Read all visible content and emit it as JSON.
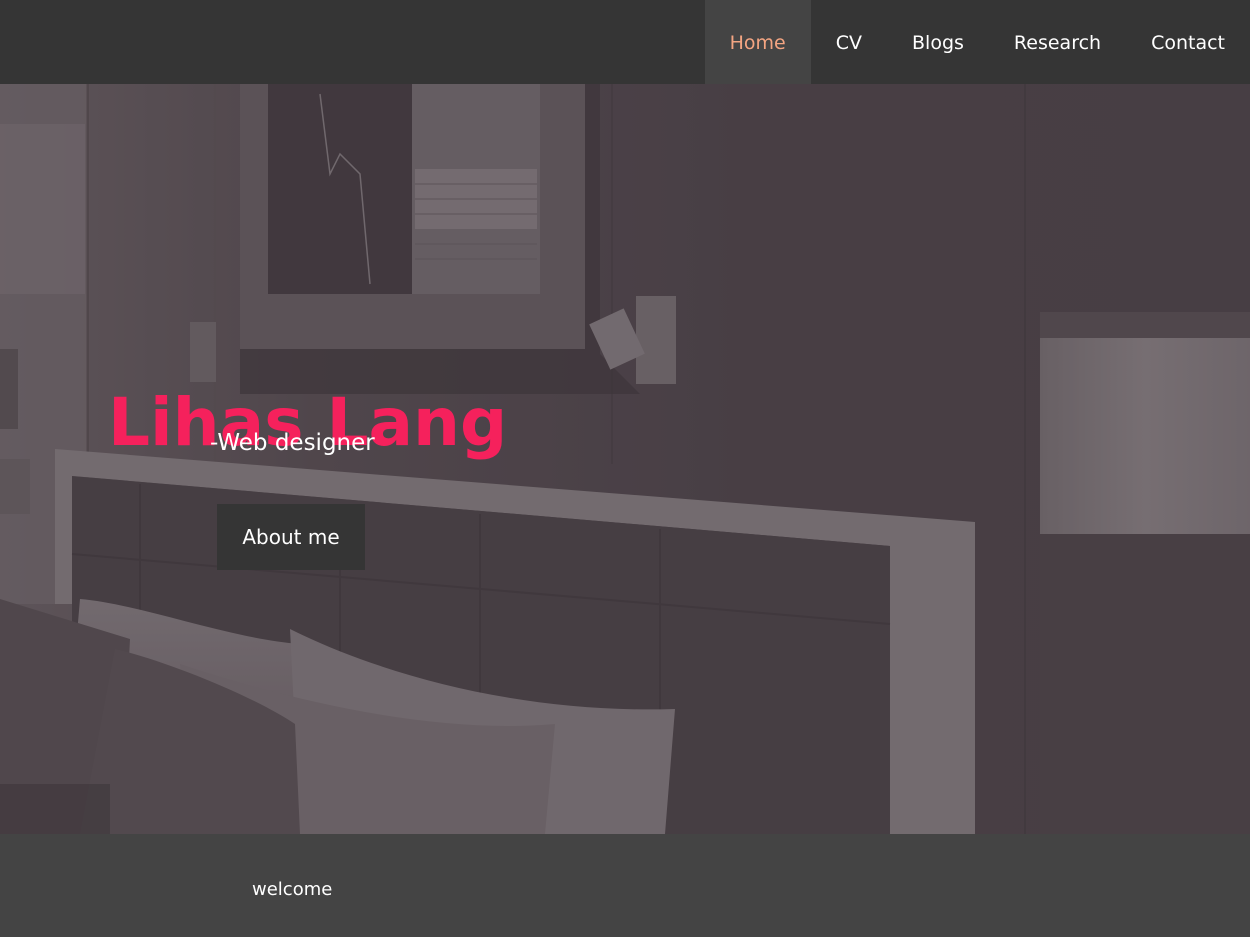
{
  "nav": {
    "items": [
      {
        "label": "Home",
        "active": true
      },
      {
        "label": "CV",
        "active": false
      },
      {
        "label": "Blogs",
        "active": false
      },
      {
        "label": "Research",
        "active": false
      },
      {
        "label": "Contact",
        "active": false
      }
    ]
  },
  "hero": {
    "name": "Lihas Lang",
    "role": "-Web designer",
    "button_label": "About me",
    "background_image": "hotel-bedroom-photo"
  },
  "footer": {
    "welcome": "welcome"
  },
  "colors": {
    "nav_bg": "#353535",
    "nav_active_bg": "#444444",
    "nav_active_text": "#f4a582",
    "name_accent": "#f5215c",
    "hero_tint": "#4f474c",
    "footer_bg": "#444444"
  }
}
